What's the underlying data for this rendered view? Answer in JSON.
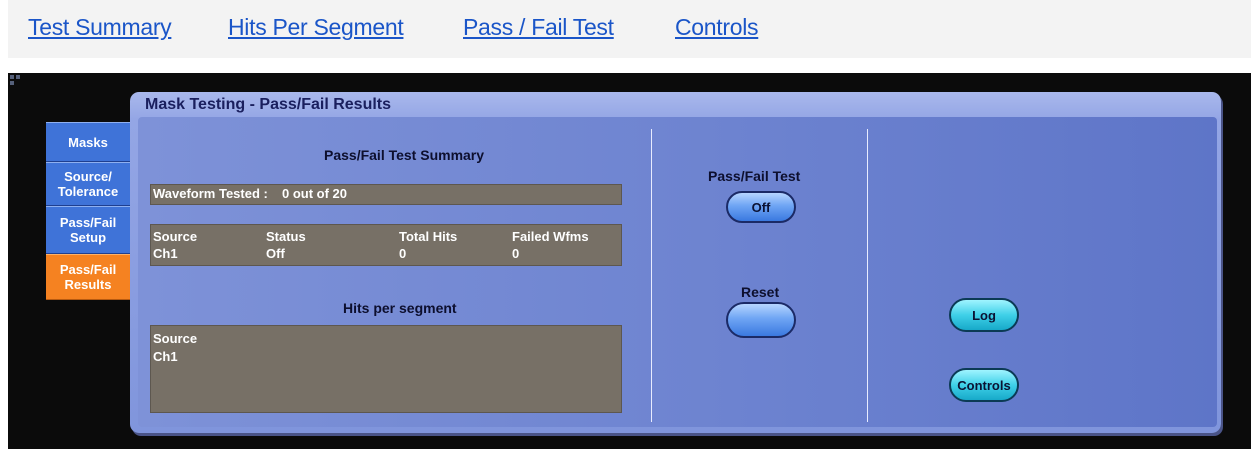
{
  "nav": {
    "links": [
      "Test Summary",
      "Hits Per Segment",
      "Pass / Fail Test",
      "Controls"
    ]
  },
  "panel": {
    "title": "Mask Testing - Pass/Fail Results"
  },
  "tabs": [
    {
      "label": "Masks",
      "active": false
    },
    {
      "label": "Source/\nTolerance",
      "active": false
    },
    {
      "label": "Pass/Fail\nSetup",
      "active": false
    },
    {
      "label": "Pass/Fail\nResults",
      "active": true
    }
  ],
  "summary": {
    "heading": "Pass/Fail Test Summary",
    "waveform_label": "Waveform Tested :",
    "waveform_value": "0 out of 20",
    "columns": [
      "Source",
      "Status",
      "Total Hits",
      "Failed Wfms"
    ],
    "row": [
      "Ch1",
      "Off",
      "0",
      "0"
    ]
  },
  "segments": {
    "heading": "Hits per segment",
    "header": "Source",
    "rows": [
      "Ch1"
    ]
  },
  "controls": {
    "pass_fail_label": "Pass/Fail Test",
    "pass_fail_value": "Off",
    "reset_label": "Reset",
    "log_button": "Log",
    "controls_button": "Controls"
  },
  "colors": {
    "tab_active": "#f58221",
    "tab_inactive": "#3f73d8",
    "panel": "#8095dc",
    "table_bg": "#777066",
    "link": "#1a55c8"
  }
}
